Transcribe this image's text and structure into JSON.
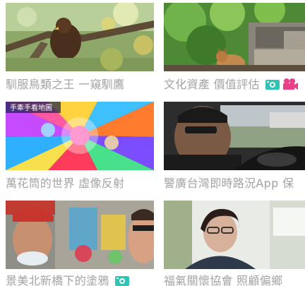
{
  "videos": [
    {
      "title": "馴服鳥類之王 一窺馴鷹",
      "badges": []
    },
    {
      "title": "文化資產 價值評估",
      "badges": [
        "photo-icon",
        "video-camera-icon"
      ]
    },
    {
      "title": "萬花筒的世界 虛像反射",
      "badges": [],
      "overlay": "手牽手看地圖"
    },
    {
      "title": "警廣台灣即時路況App 保",
      "badges": []
    },
    {
      "title": "景美北新橋下的塗鴉",
      "badges": [
        "photo-icon"
      ]
    },
    {
      "title": "福氣關懷協會 照顧偏鄉",
      "badges": []
    }
  ],
  "colors": {
    "caption": "#a3a3a3",
    "photo_badge": "#2ec4b6",
    "video_badge": "#e8418a"
  }
}
